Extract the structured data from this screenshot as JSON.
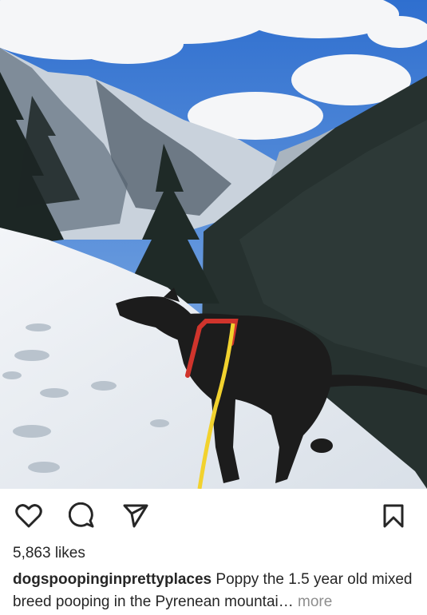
{
  "post": {
    "image_alt": "Black dog on a snowy mountain trail in the Pyrenees",
    "likes_text": "5,863 likes",
    "username": "dogspoopinginprettyplaces",
    "caption": "Poppy the 1.5 year old mixed breed pooping in the Pyrenean mountai",
    "ellipsis": "…",
    "more_label": "more"
  },
  "actions": {
    "like_icon": "heart-icon",
    "comment_icon": "comment-icon",
    "share_icon": "send-icon",
    "save_icon": "bookmark-icon"
  },
  "colors": {
    "sky": "#3f7fd6",
    "snow": "#eef2f6",
    "forest": "#1f2b2c",
    "dog": "#1c1c1c",
    "harness": "#d0342c",
    "leash": "#f2d22e",
    "text": "#262626",
    "muted": "#8e8e8e"
  }
}
